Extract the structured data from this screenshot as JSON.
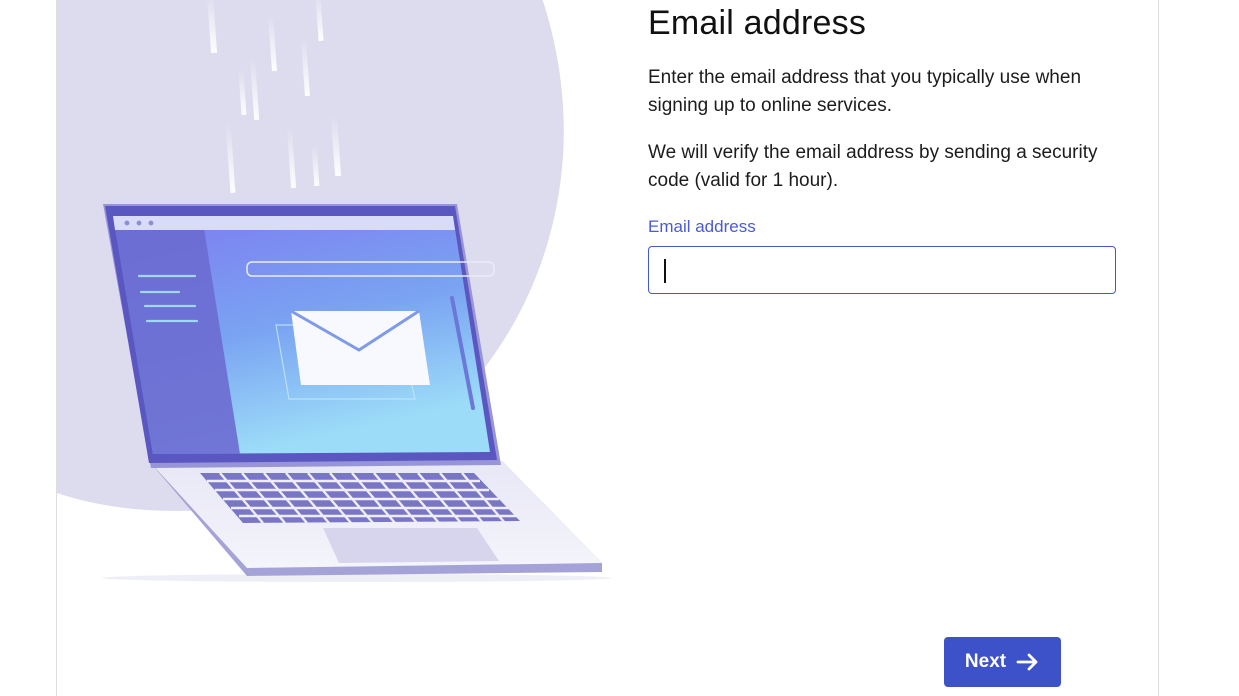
{
  "form": {
    "title": "Email address",
    "paragraph_1": "Enter the email address that you typically use when signing up to online services.",
    "paragraph_2": "We will verify the email address by sending a security code (valid for 1 hour).",
    "field_label": "Email address",
    "field_value": ""
  },
  "actions": {
    "next_label": "Next",
    "next_icon": "arrow-right-icon"
  },
  "colors": {
    "accent": "#3d52c8",
    "label": "#4a5bd4",
    "bg_circle": "#dddcee"
  }
}
